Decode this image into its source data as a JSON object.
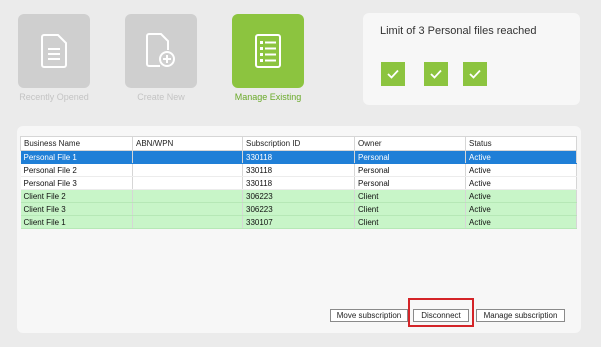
{
  "tiles": [
    {
      "label": "Recently Opened",
      "icon": "document-icon",
      "state": "disabled"
    },
    {
      "label": "Create New",
      "icon": "document-add-icon",
      "state": "disabled"
    },
    {
      "label": "Manage Existing",
      "icon": "list-document-icon",
      "state": "active"
    }
  ],
  "limit_panel": {
    "message": "Limit of 3 Personal files reached",
    "checks": [
      "check-icon",
      "check-icon",
      "check-icon"
    ]
  },
  "table": {
    "columns": [
      "Business Name",
      "ABN/WPN",
      "Subscription ID",
      "Owner",
      "Status"
    ],
    "rows": [
      {
        "business_name": "Personal File 1",
        "abn_wpn": "",
        "subscription_id": "330118",
        "owner": "Personal",
        "status": "Active",
        "selected": true
      },
      {
        "business_name": "Personal File 2",
        "abn_wpn": "",
        "subscription_id": "330118",
        "owner": "Personal",
        "status": "Active"
      },
      {
        "business_name": "Personal File 3",
        "abn_wpn": "",
        "subscription_id": "330118",
        "owner": "Personal",
        "status": "Active"
      },
      {
        "business_name": "Client File 2",
        "abn_wpn": "",
        "subscription_id": "306223",
        "owner": "Client",
        "status": "Active"
      },
      {
        "business_name": "Client File 3",
        "abn_wpn": "",
        "subscription_id": "306223",
        "owner": "Client",
        "status": "Active"
      },
      {
        "business_name": "Client File 1",
        "abn_wpn": "",
        "subscription_id": "330107",
        "owner": "Client",
        "status": "Active"
      }
    ]
  },
  "buttons": {
    "move": "Move subscription",
    "disconnect": "Disconnect",
    "manage": "Manage subscription"
  },
  "colors": {
    "accent": "#8cc43f",
    "selected_row": "#1f7fd7",
    "client_row": "#c8f5c8",
    "highlight": "#d42428"
  }
}
